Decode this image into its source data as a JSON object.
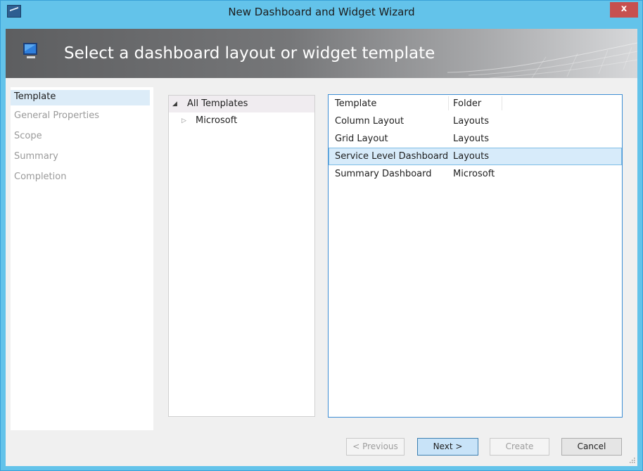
{
  "window": {
    "title": "New Dashboard and Widget Wizard",
    "close_label": "x"
  },
  "banner": {
    "heading": "Select a dashboard layout or widget template"
  },
  "steps": [
    {
      "label": "Template",
      "active": true
    },
    {
      "label": "General Properties",
      "active": false
    },
    {
      "label": "Scope",
      "active": false
    },
    {
      "label": "Summary",
      "active": false
    },
    {
      "label": "Completion",
      "active": false
    }
  ],
  "tree": {
    "root": {
      "label": "All Templates",
      "expanded": true
    },
    "children": [
      {
        "label": "Microsoft",
        "expanded": false
      }
    ]
  },
  "grid": {
    "columns": [
      "Template",
      "Folder"
    ],
    "rows": [
      [
        "Column Layout",
        "Layouts"
      ],
      [
        "Grid Layout",
        "Layouts"
      ],
      [
        "Service Level Dashboard",
        "Layouts"
      ],
      [
        "Summary Dashboard",
        "Microsoft"
      ]
    ],
    "selected_row": 2
  },
  "buttons": {
    "previous": "< Previous",
    "next": "Next >",
    "create": "Create",
    "cancel": "Cancel"
  },
  "colors": {
    "titlebar": "#63c3ea",
    "selection": "#d7ebfa",
    "accent_border": "#3e8ed4",
    "close": "#c7504f"
  },
  "icons": {
    "app": "app-window-icon",
    "banner": "monitor-icon",
    "expanded": "triangle-down-icon",
    "collapsed": "triangle-right-icon"
  }
}
